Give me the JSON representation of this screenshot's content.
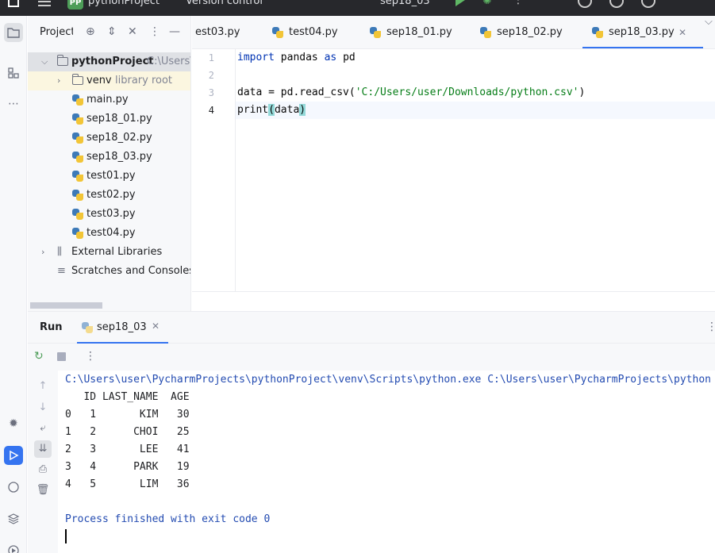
{
  "titlebar": {
    "project_badge": "PP",
    "project_name": "pythonProject",
    "version_control": "Version control",
    "run_config": "sep18_03"
  },
  "toolstrip": {
    "items": [
      "project-icon",
      "structure-icon",
      "more-icon",
      "debug-icon",
      "run-icon",
      "python-console-icon",
      "layers-icon",
      "services-icon"
    ]
  },
  "project_panel": {
    "title": "Project",
    "root_name": "pythonProject",
    "root_path": "C:\\Users\\",
    "venv_name": "venv",
    "venv_sub": "library root",
    "files": [
      "main.py",
      "sep18_01.py",
      "sep18_02.py",
      "sep18_03.py",
      "test01.py",
      "test02.py",
      "test03.py",
      "test04.py"
    ],
    "external_libraries": "External Libraries",
    "scratches": "Scratches and Consoles"
  },
  "tabs": [
    {
      "label": "est03.py",
      "active": false
    },
    {
      "label": "test04.py",
      "active": false
    },
    {
      "label": "sep18_01.py",
      "active": false
    },
    {
      "label": "sep18_02.py",
      "active": false
    },
    {
      "label": "sep18_03.py",
      "active": true
    }
  ],
  "editor": {
    "line_numbers": [
      "1",
      "2",
      "3",
      "4"
    ],
    "line1_kw1": "import",
    "line1_mid": " pandas ",
    "line1_kw2": "as",
    "line1_end": " pd",
    "line3_pre": "data = pd.read_csv(",
    "line3_str": "'C:/Users/user/Downloads/python.csv'",
    "line3_post": ")",
    "line4_fn": "print",
    "line4_open": "(",
    "line4_arg": "data",
    "line4_close": ")"
  },
  "run_panel": {
    "title": "Run",
    "tab_label": "sep18_03",
    "console_lines": [
      "C:\\Users\\user\\PycharmProjects\\pythonProject\\venv\\Scripts\\python.exe C:\\Users\\user\\PycharmProjects\\python",
      "   ID LAST_NAME  AGE",
      "0   1       KIM   30",
      "1   2      CHOI   25",
      "2   3       LEE   41",
      "3   4      PARK   19",
      "4   5       LIM   36",
      "",
      "Process finished with exit code 0"
    ]
  },
  "colors": {
    "accent": "#3574f0",
    "keyword": "#0033b3",
    "string": "#067d17",
    "console_blue": "#234bb1",
    "run_green": "#5fb865"
  }
}
